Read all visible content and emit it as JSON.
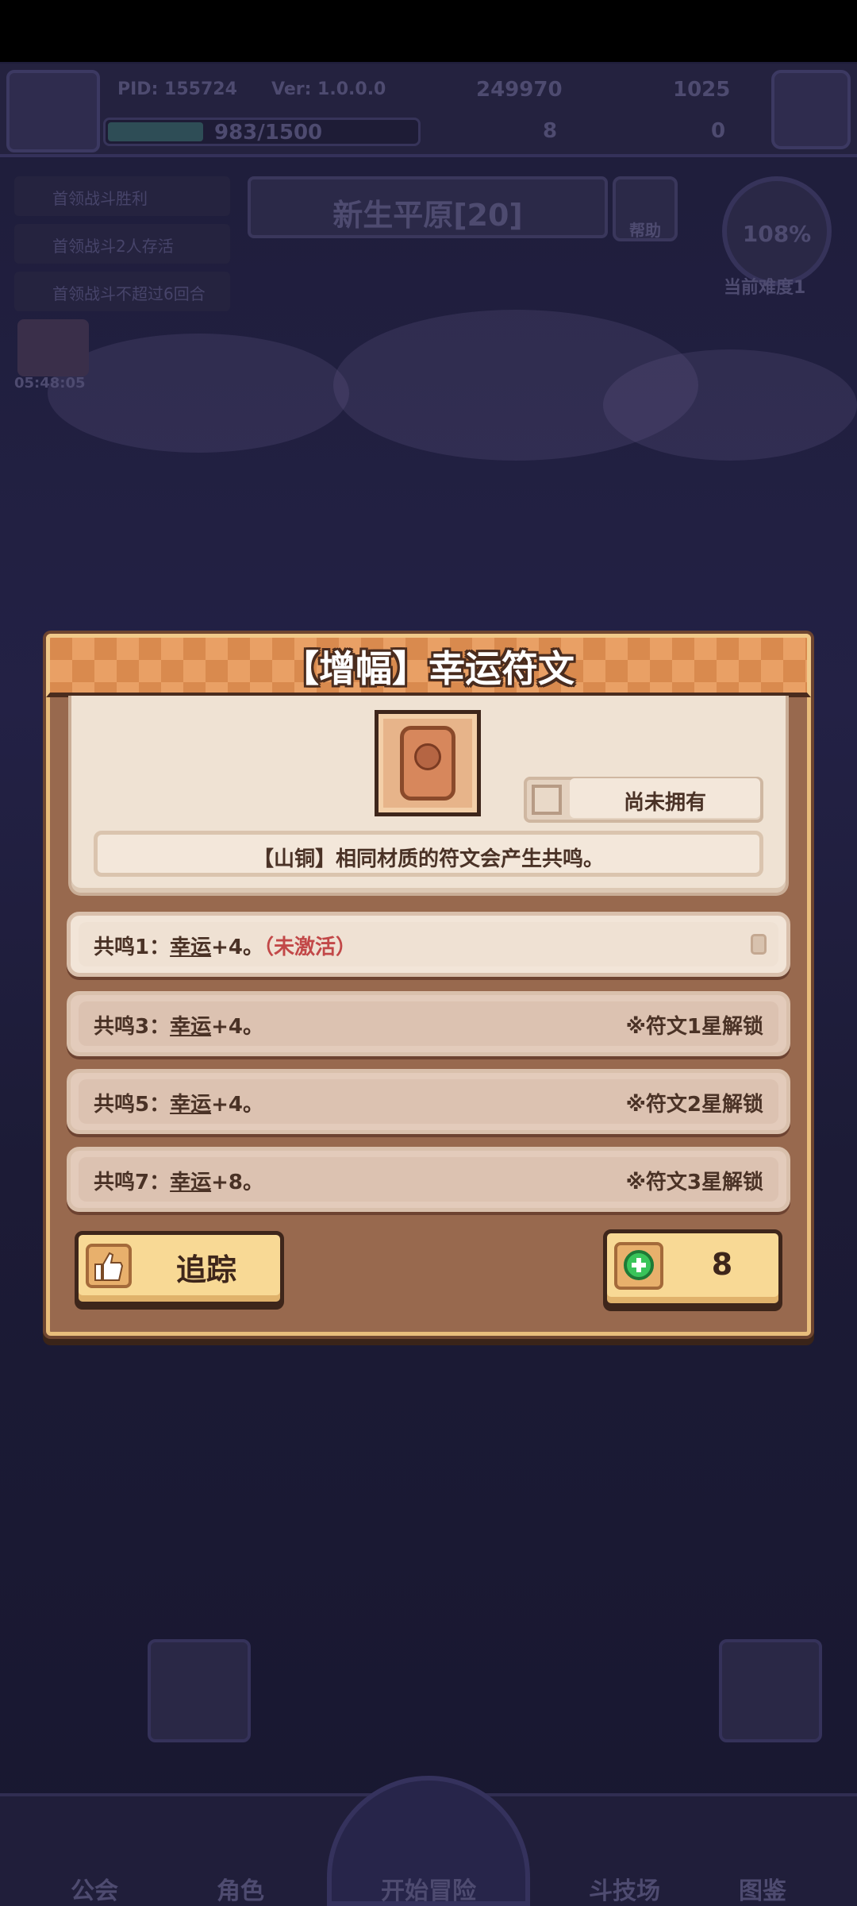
{
  "background": {
    "player": {
      "pid": "PID: 155724",
      "version": "Ver: 1.0.0.0",
      "xp": "983/1500",
      "coins": "249970",
      "gems": "1025",
      "clovers": "8",
      "other_currency": "0"
    },
    "quests": [
      "首领战斗胜利",
      "首领战斗2人存活",
      "首领战斗不超过6回合"
    ],
    "area": {
      "title": "新生平原[20]",
      "help_label": "帮助",
      "difficulty_value": "108%",
      "difficulty_label": "当前难度1"
    },
    "chest_timer": "05:48:05",
    "nav": [
      "公会",
      "角色",
      "开始冒险",
      "斗技场",
      "图鉴"
    ]
  },
  "dialog": {
    "title": "【增幅】幸运符文",
    "rune_icon": "rune-tablet-icon",
    "ownership_status": "尚未拥有",
    "description": "【山铜】相同材质的符文会产生共鸣。",
    "resonances": [
      {
        "label": "共鸣1：",
        "stat": "幸运",
        "bonus": "+4。",
        "status": "（未激活）",
        "requirement": ""
      },
      {
        "label": "共鸣3：",
        "stat": "幸运",
        "bonus": "+4。",
        "status": "",
        "requirement": "※符文1星解锁"
      },
      {
        "label": "共鸣5：",
        "stat": "幸运",
        "bonus": "+4。",
        "status": "",
        "requirement": "※符文2星解锁"
      },
      {
        "label": "共鸣7：",
        "stat": "幸运",
        "bonus": "+8。",
        "status": "",
        "requirement": "※符文3星解锁"
      }
    ],
    "track_button": {
      "label": "追踪",
      "icon": "thumbs-up-icon"
    },
    "cost_button": {
      "value": "8",
      "icon": "clover-icon"
    }
  },
  "colors": {
    "title_bar": "#d98a4e",
    "panel_bg": "#98694e",
    "card_bg": "#efe2d3",
    "button_bg": "#f8d995",
    "inactive_red": "#c24848"
  }
}
